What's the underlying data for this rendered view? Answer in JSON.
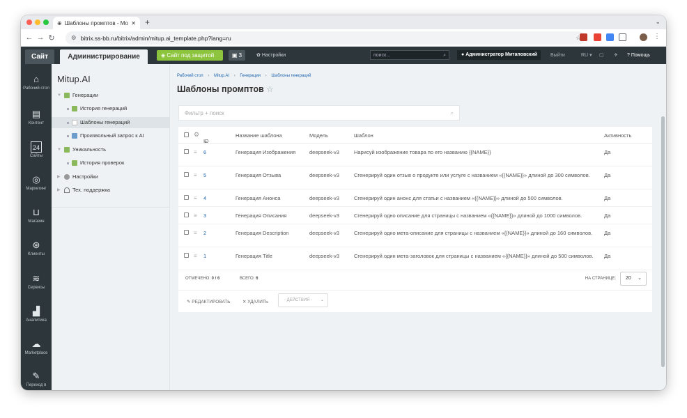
{
  "browser": {
    "tab_title": "Шаблоны промптов - Моя к...",
    "url": "bitrix.ss-bb.ru/bitrix/admin/mitup.ai_template.php?lang=ru",
    "new_tab": "+"
  },
  "adminbar": {
    "site": "Сайт",
    "admin": "Администрирование",
    "protection": "Сайт под защитой",
    "notifications": "3",
    "settings": "Настройки",
    "search_placeholder": "поиск...",
    "user": "Администратор Митаповский",
    "logout": "Выйти",
    "lang": "RU",
    "help": "Помощь"
  },
  "leftnav": [
    {
      "label": "Рабочий стол",
      "icon": "home-icon"
    },
    {
      "label": "Контент",
      "icon": "document-icon"
    },
    {
      "label": "Сайты",
      "icon": "calendar-icon"
    },
    {
      "label": "Маркетинг",
      "icon": "target-icon"
    },
    {
      "label": "Магазин",
      "icon": "cart-icon"
    },
    {
      "label": "Клиенты",
      "icon": "clients-icon"
    },
    {
      "label": "Сервисы",
      "icon": "layers-icon"
    },
    {
      "label": "Аналитика",
      "icon": "chart-icon"
    },
    {
      "label": "Marketplace",
      "icon": "cloud-icon"
    },
    {
      "label": "Переход в",
      "icon": "edit-icon"
    }
  ],
  "tree": {
    "title": "Mitup.AI",
    "items": [
      {
        "label": "Генерации"
      },
      {
        "label": "История генераций"
      },
      {
        "label": "Шаблоны генераций"
      },
      {
        "label": "Произвольный запрос к AI"
      },
      {
        "label": "Уникальность"
      },
      {
        "label": "История проверок"
      },
      {
        "label": "Настройки"
      },
      {
        "label": "Тех. поддержка"
      }
    ]
  },
  "breadcrumb": [
    "Рабочий стол",
    "Mitup.AI",
    "Генерации",
    "Шаблоны генераций"
  ],
  "page_title": "Шаблоны промптов",
  "filter_placeholder": "Фильтр + поиск",
  "table": {
    "headers": {
      "id": "ID",
      "name": "Название шаблона",
      "model": "Модель",
      "template": "Шаблон",
      "active": "Активность"
    },
    "rows": [
      {
        "id": "6",
        "name": "Генерация Изображения",
        "model": "deepseek-v3",
        "template": "Нарисуй изображение товара по его названию {{NAME}}",
        "active": "Да"
      },
      {
        "id": "5",
        "name": "Генерация Отзыва",
        "model": "deepseek-v3",
        "template": "Сгенерируй один отзыв о продукте или услуге с названием «{{NAME}}» длиной до 300 символов.",
        "active": "Да"
      },
      {
        "id": "4",
        "name": "Генерация Анонса",
        "model": "deepseek-v3",
        "template": "Сгенерируй один анонс для статьи с названием «{{NAME}}» длиной до 500 символов.",
        "active": "Да"
      },
      {
        "id": "3",
        "name": "Генерация Описания",
        "model": "deepseek-v3",
        "template": "Сгенерируй одно описание для страницы с названием «{{NAME}}» длиной до 1000 символов.",
        "active": "Да"
      },
      {
        "id": "2",
        "name": "Генерация Description",
        "model": "deepseek-v3",
        "template": "Сгенерируй одно мета-описание для страницы с названием «{{NAME}}» длиной до 160 символов.",
        "active": "Да"
      },
      {
        "id": "1",
        "name": "Генерация Title",
        "model": "deepseek-v3",
        "template": "Сгенерируй один мета-заголовок для страницы с названием «{{NAME}}» длиной до 500 символов.",
        "active": "Да"
      }
    ]
  },
  "footer": {
    "selected_label": "ОТМЕЧЕНО:",
    "selected_value": "0 / 6",
    "total_label": "ВСЕГО:",
    "total_value": "6",
    "perpage_label": "НА СТРАНИЦЕ:",
    "perpage_value": "20"
  },
  "actions": {
    "edit": "РЕДАКТИРОВАТЬ",
    "delete": "УДАЛИТЬ",
    "dropdown": "- ДЕЙСТВИЯ -"
  }
}
